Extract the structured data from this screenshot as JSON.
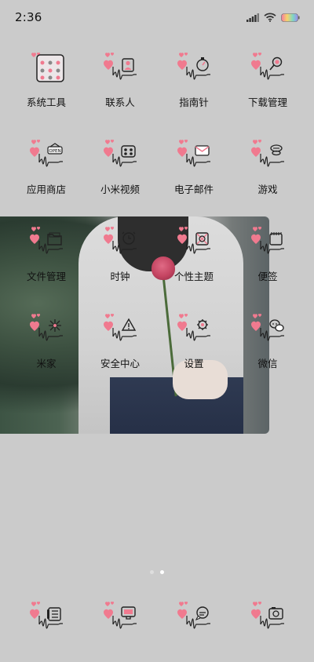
{
  "status_bar": {
    "time": "2:36"
  },
  "apps": [
    {
      "label": "系统工具",
      "icon": "folder-icon"
    },
    {
      "label": "联系人",
      "icon": "contact-card-icon"
    },
    {
      "label": "指南针",
      "icon": "compass-icon"
    },
    {
      "label": "下载管理",
      "icon": "download-icon"
    },
    {
      "label": "应用商店",
      "icon": "open-sign-icon"
    },
    {
      "label": "小米视频",
      "icon": "video-icon"
    },
    {
      "label": "电子邮件",
      "icon": "mail-icon"
    },
    {
      "label": "游戏",
      "icon": "game-controller-icon"
    },
    {
      "label": "文件管理",
      "icon": "folder-file-icon"
    },
    {
      "label": "时钟",
      "icon": "clock-icon"
    },
    {
      "label": "个性主题",
      "icon": "theme-icon"
    },
    {
      "label": "便签",
      "icon": "notepad-icon"
    },
    {
      "label": "米家",
      "icon": "snowflake-icon"
    },
    {
      "label": "安全中心",
      "icon": "warning-icon"
    },
    {
      "label": "设置",
      "icon": "gear-icon"
    },
    {
      "label": "微信",
      "icon": "chat-bubbles-icon"
    }
  ],
  "dock": [
    {
      "icon": "phone-icon"
    },
    {
      "icon": "computer-icon"
    },
    {
      "icon": "message-icon"
    },
    {
      "icon": "camera-icon"
    }
  ],
  "pager": {
    "pages": 2,
    "current": 2
  },
  "colors": {
    "background": "#cbcbcb",
    "heart": "#f07a8f",
    "line": "#222222"
  }
}
